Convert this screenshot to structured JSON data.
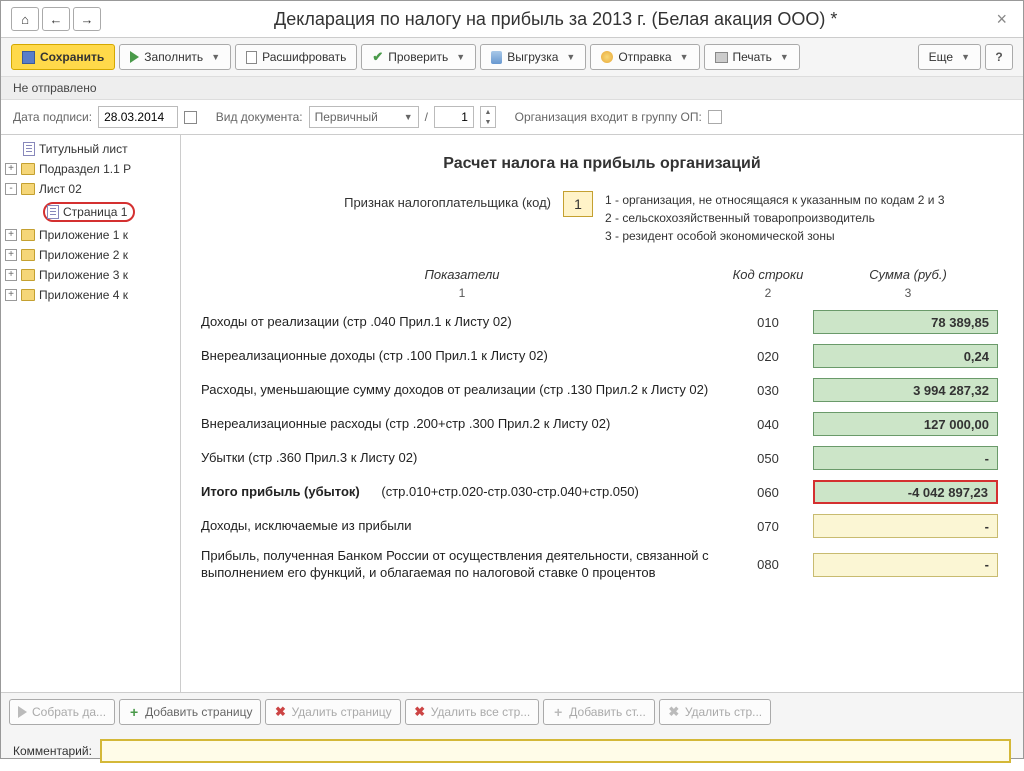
{
  "window": {
    "title": "Декларация по налогу на прибыль за 2013 г. (Белая акация ООО) *"
  },
  "toolbar": {
    "save": "Сохранить",
    "fill": "Заполнить",
    "decode": "Расшифровать",
    "check": "Проверить",
    "export": "Выгрузка",
    "send": "Отправка",
    "print": "Печать",
    "more": "Еще"
  },
  "status": "Не отправлено",
  "params": {
    "date_label": "Дата подписи:",
    "date_value": "28.03.2014",
    "doc_type_label": "Вид документа:",
    "doc_type_value": "Первичный",
    "num_value": "1",
    "org_label": "Организация входит в группу ОП:"
  },
  "tree": {
    "items": [
      {
        "label": "Титульный лист",
        "icon": "page",
        "level": 1
      },
      {
        "label": "Подраздел 1.1 Р",
        "icon": "folder",
        "level": 0,
        "exp": "+"
      },
      {
        "label": "Лист 02",
        "icon": "folder",
        "level": 0,
        "exp": "-"
      },
      {
        "label": "Страница 1",
        "icon": "page",
        "level": 2,
        "circled": true
      },
      {
        "label": "Приложение 1 к",
        "icon": "folder",
        "level": 0,
        "exp": "+"
      },
      {
        "label": "Приложение 2 к",
        "icon": "folder",
        "level": 0,
        "exp": "+"
      },
      {
        "label": "Приложение 3 к",
        "icon": "folder",
        "level": 0,
        "exp": "+"
      },
      {
        "label": "Приложение 4 к",
        "icon": "folder",
        "level": 0,
        "exp": "+"
      }
    ]
  },
  "form": {
    "title": "Расчет налога на прибыль организаций",
    "taxpayer_label": "Признак налогоплательщика (код)",
    "taxpayer_code": "1",
    "legend1": "1 - организация, не относящаяся к указанным по кодам 2 и 3",
    "legend2": "2 - сельскохозяйственный товаропроизводитель",
    "legend3": "3 - резидент особой экономической зоны",
    "col1": "Показатели",
    "col2": "Код строки",
    "col3": "Сумма (руб.)",
    "n1": "1",
    "n2": "2",
    "n3": "3",
    "rows": [
      {
        "desc": "Доходы от реализации (стр .040 Прил.1 к Листу 02)",
        "code": "010",
        "val": "78 389,85",
        "style": "green"
      },
      {
        "desc": "Внереализационные доходы (стр .100 Прил.1 к Листу 02)",
        "code": "020",
        "val": "0,24",
        "style": "green"
      },
      {
        "desc": "Расходы, уменьшающие сумму доходов от реализации (стр .130 Прил.2 к Листу 02)",
        "code": "030",
        "val": "3 994 287,32",
        "style": "green"
      },
      {
        "desc": "Внереализационные расходы (стр .200+стр .300 Прил.2 к Листу 02)",
        "code": "040",
        "val": "127 000,00",
        "style": "green"
      },
      {
        "desc": "Убытки (стр .360 Прил.3 к Листу 02)",
        "code": "050",
        "val": "-",
        "style": "green"
      },
      {
        "desc_html": "<span class='bold'>Итого прибыль (убыток)</span> &nbsp;&nbsp;&nbsp;&nbsp; (стр.010+стр.020-стр.030-стр.040+стр.050)",
        "code": "060",
        "val": "-4 042 897,23",
        "style": "hl"
      },
      {
        "desc": "Доходы, исключаемые из прибыли",
        "code": "070",
        "val": "-",
        "style": "yel"
      },
      {
        "desc": "Прибыль, полученная Банком России от осуществления деятельности, связанной с выполнением его функций, и облагаемая по налоговой ставке 0 процентов",
        "code": "080",
        "val": "-",
        "style": "yel"
      }
    ]
  },
  "bottom": {
    "collect": "Собрать да...",
    "add_page": "Добавить страницу",
    "del_page": "Удалить страницу",
    "del_all": "Удалить все стр...",
    "add_str": "Добавить ст...",
    "del_str": "Удалить стр..."
  },
  "comment_label": "Комментарий:"
}
